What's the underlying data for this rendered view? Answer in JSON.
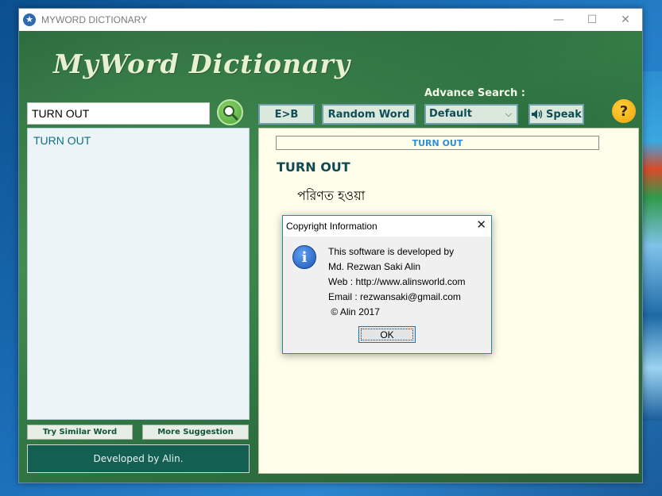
{
  "window": {
    "title": "MYWORD DICTIONARY",
    "controls": {
      "minimize": "—",
      "maximize": "☐",
      "close": "✕"
    }
  },
  "logo": "MyWord Dictionary",
  "search": {
    "value": "TURN OUT"
  },
  "word_list": {
    "items": [
      "TURN OUT"
    ]
  },
  "left_buttons": {
    "similar": "Try Similar Word",
    "suggestion": "More Suggestion"
  },
  "developed_by": "Developed by Alin.",
  "toolbar": {
    "eb_label": "E>B",
    "random_label": "Random Word",
    "advance_label": "Advance Search :",
    "select_value": "Default",
    "speak_label": "Speak",
    "help_label": "?"
  },
  "content": {
    "header_word": "TURN OUT",
    "title": "TURN OUT",
    "meaning": "পরিণত হওয়া"
  },
  "dialog": {
    "title": "Copyright Information",
    "lines": [
      "This software is developed by",
      "Md. Rezwan Saki Alin",
      "Web : http://www.alinsworld.com",
      "Email : rezwansaki@gmail.com",
      " © Alin 2017"
    ],
    "ok_label": "OK"
  },
  "icons": {
    "app": "app-icon",
    "search": "magnifier-icon",
    "speaker": "speaker-icon",
    "help": "question-icon",
    "info": "info-icon"
  },
  "colors": {
    "background_green": "#2f7442",
    "content_bg": "#fefeea",
    "accent_teal": "#135f52",
    "link_blue": "#2f8fd6"
  }
}
